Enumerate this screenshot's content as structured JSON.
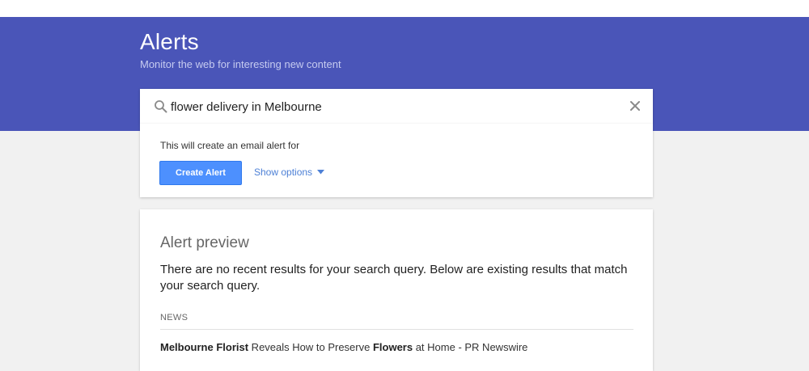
{
  "header": {
    "title": "Alerts",
    "subtitle": "Monitor the web for interesting new content"
  },
  "search": {
    "value": "flower delivery in Melbourne",
    "icon": "search-icon",
    "clear_icon": "close-icon"
  },
  "create": {
    "note": "This will create an email alert for",
    "button_label": "Create Alert",
    "options_label": "Show options",
    "options_icon": "caret-down-icon"
  },
  "preview": {
    "title": "Alert preview",
    "message": "There are no recent results for your search query. Below are existing results that match your search query.",
    "section_label": "NEWS",
    "items": [
      {
        "part1_bold": "Melbourne Florist",
        "part2": " Reveals How to Preserve ",
        "part3_bold": "Flowers",
        "part4": " at Home - PR Newswire"
      }
    ]
  },
  "colors": {
    "banner": "#4a55b8",
    "button": "#4d90fe",
    "link": "#4d80d6"
  }
}
